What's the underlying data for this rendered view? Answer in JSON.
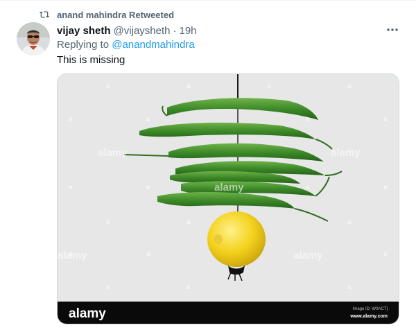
{
  "retweet": {
    "label": "anand mahindra Retweeted",
    "icon": "retweet-icon"
  },
  "tweet": {
    "author_name": "vijay sheth",
    "author_handle": "@vijaysheth",
    "separator": "·",
    "time": "19h",
    "replying_prefix": "Replying to ",
    "replying_to": "@anandmahindra",
    "text": "This is missing",
    "more_icon": "more-options-icon"
  },
  "media": {
    "watermark": "alamy",
    "watermark_small": "a",
    "footer_logo": "alamy",
    "image_id": "Image ID: W0ACT]",
    "site": "www.alamy.com"
  },
  "colors": {
    "link": "#1d9bf0",
    "muted": "#536471",
    "chili": "#3f8a2a",
    "lemon": "#f2d21e",
    "photo_bg": "#e6e7e6"
  }
}
